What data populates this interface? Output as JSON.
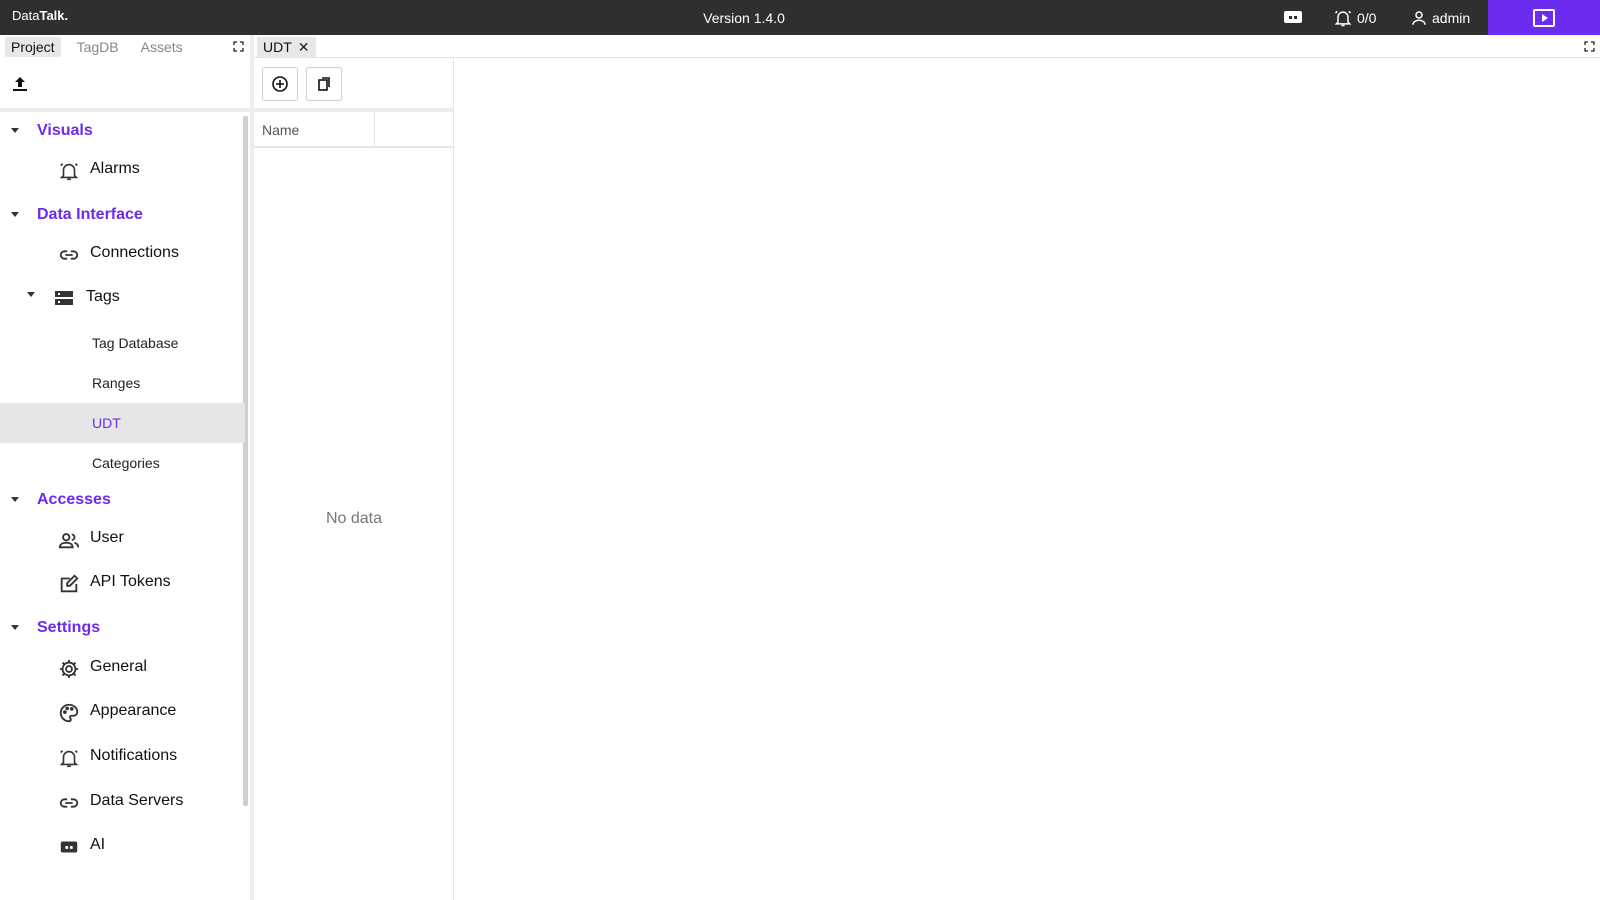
{
  "app": {
    "logo_prefix": "Data",
    "logo_bold": "Talk.",
    "version": "Version 1.4.0",
    "alarm_count": "0/0",
    "user": "admin",
    "accent": "#6c2bf0"
  },
  "left_tabs": [
    "Project",
    "TagDB",
    "Assets"
  ],
  "tree": {
    "visuals": {
      "label": "Visuals",
      "items": {
        "alarms": "Alarms"
      }
    },
    "data_interface": {
      "label": "Data Interface",
      "connections": "Connections",
      "tags": "Tags",
      "tag_children": {
        "tag_database": "Tag Database",
        "ranges": "Ranges",
        "udt": "UDT",
        "categories": "Categories"
      }
    },
    "accesses": {
      "label": "Accesses",
      "user": "User",
      "api_tokens": "API Tokens"
    },
    "settings": {
      "label": "Settings",
      "general": "General",
      "appearance": "Appearance",
      "notifications": "Notifications",
      "data_servers": "Data Servers",
      "ai": "AI"
    }
  },
  "doc_tab": {
    "label": "UDT",
    "close": "✕"
  },
  "table": {
    "column_name": "Name",
    "empty_text": "No data"
  },
  "icons": {
    "top_ai": "ai-chat-icon",
    "top_alarm": "alarm-bell-icon",
    "top_user": "user-icon",
    "top_play": "presentation-play-icon",
    "upload": "upload-icon",
    "expand": "expand-icon",
    "add": "add-circle-icon",
    "copy": "copy-icon"
  }
}
